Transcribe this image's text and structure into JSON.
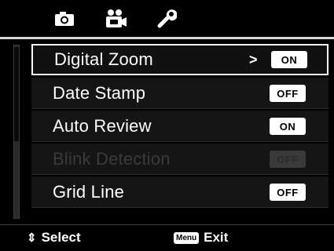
{
  "tabs": [
    {
      "icon": "camera-icon"
    },
    {
      "icon": "video-camera-icon"
    },
    {
      "icon": "wrench-icon"
    }
  ],
  "menu": {
    "items": [
      {
        "label": "Digital Zoom",
        "value": "ON",
        "selected": true,
        "has_submenu": true,
        "submenu_glyph": ">",
        "enabled": true
      },
      {
        "label": "Date Stamp",
        "value": "OFF",
        "selected": false,
        "enabled": true
      },
      {
        "label": "Auto Review",
        "value": "ON",
        "selected": false,
        "enabled": true
      },
      {
        "label": "Blink Detection",
        "value": "OFF",
        "selected": false,
        "enabled": false
      },
      {
        "label": "Grid Line",
        "value": "OFF",
        "selected": false,
        "enabled": true
      }
    ]
  },
  "footer": {
    "select_label": "Select",
    "menu_key": "Menu",
    "exit_label": "Exit"
  },
  "colors": {
    "background": "#000000",
    "selection_border": "#ffffff",
    "disabled_text": "#3b3b3b"
  }
}
